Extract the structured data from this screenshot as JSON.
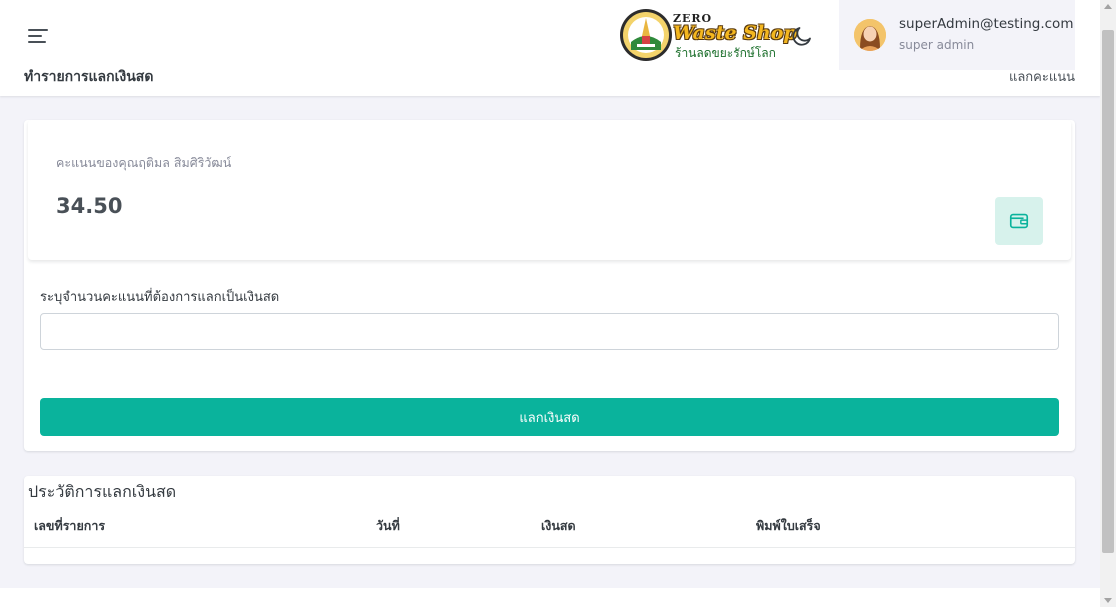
{
  "header": {
    "page_title": "ทำรายการแลกเงินสด",
    "breadcrumb": "แลกคะแนน",
    "logo": {
      "zero": "ZERO",
      "brand": "Waste Shop",
      "tagline": "ร้านลดขยะรักษ์โลก"
    },
    "user": {
      "email": "superAdmin@testing.com",
      "role": "super admin"
    }
  },
  "points": {
    "label": "คะแนนของคุณฤติมล สิมศิริวัฒน์",
    "value": "34.50"
  },
  "redeem_form": {
    "amount_label": "ระบุจำนวนคะแนนที่ต้องการแลกเป็นเงินสด",
    "amount_value": "",
    "submit_label": "แลกเงินสด"
  },
  "history": {
    "title": "ประวัติการแลกเงินสด",
    "columns": [
      "เลขที่รายการ",
      "วันที่",
      "เงินสด",
      "พิมพ์ใบเสร็จ"
    ],
    "rows": []
  },
  "colors": {
    "primary": "#0ab39c",
    "background": "#f3f3f9",
    "wallet_bg": "#d7f2ec"
  },
  "icons": {
    "menu": "hamburger-icon",
    "theme": "moon-icon",
    "wallet": "wallet-icon"
  }
}
